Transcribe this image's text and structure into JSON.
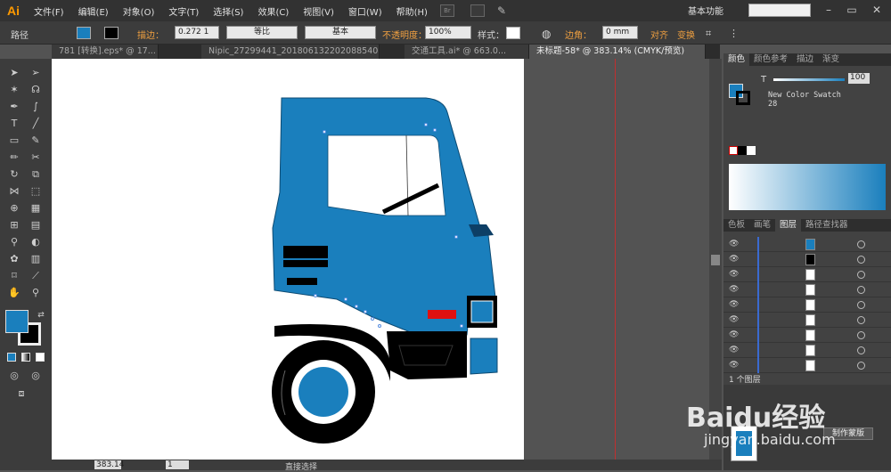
{
  "app": {
    "logo": "Ai",
    "workspace": "基本功能"
  },
  "menu": [
    "文件(F)",
    "编辑(E)",
    "对象(O)",
    "文字(T)",
    "选择(S)",
    "效果(C)",
    "视图(V)",
    "窗口(W)",
    "帮助(H)"
  ],
  "menubar_badge": "Br",
  "control": {
    "object_type": "路径",
    "stroke_label": "描边：",
    "stroke_value": "0.272 1",
    "profile_label": "等比",
    "brush_label": "基本",
    "opacity_label": "不透明度：",
    "opacity_value": "100%",
    "style_label": "样式：",
    "corner_label": "边角：",
    "corner_value": "0 mm",
    "align_label": "对齐",
    "transform_label": "变换",
    "fill_color": "#1a7fbd",
    "stroke_color": "#000000"
  },
  "tabs": [
    "781 [转换].eps* @ 17...",
    "Nipic_27299441_20180613220208854088.ai* @",
    "交通工具.ai* @ 663.0...",
    "未标题-58* @ 383.14% (CMYK/预览)"
  ],
  "color_panel": {
    "tabs": [
      "颜色",
      "颜色参考",
      "描边",
      "渐变"
    ],
    "t_label": "T",
    "t_value": "100",
    "swatch_name": "New Color Swatch 28",
    "gradient_from": "#ffffff",
    "gradient_to": "#1a7fbd"
  },
  "layers_panel": {
    "tabs": [
      "色板",
      "画笔",
      "图层",
      "路径查找器"
    ],
    "count_label": "1 个图层"
  },
  "bottom_panel": {
    "make_mask": "制作蒙版"
  },
  "status": {
    "zoom": "383.14",
    "page": "1",
    "tool": "直接选择"
  },
  "watermark": {
    "brand": "Baidu经验",
    "url": "jingyan.baidu.com"
  }
}
